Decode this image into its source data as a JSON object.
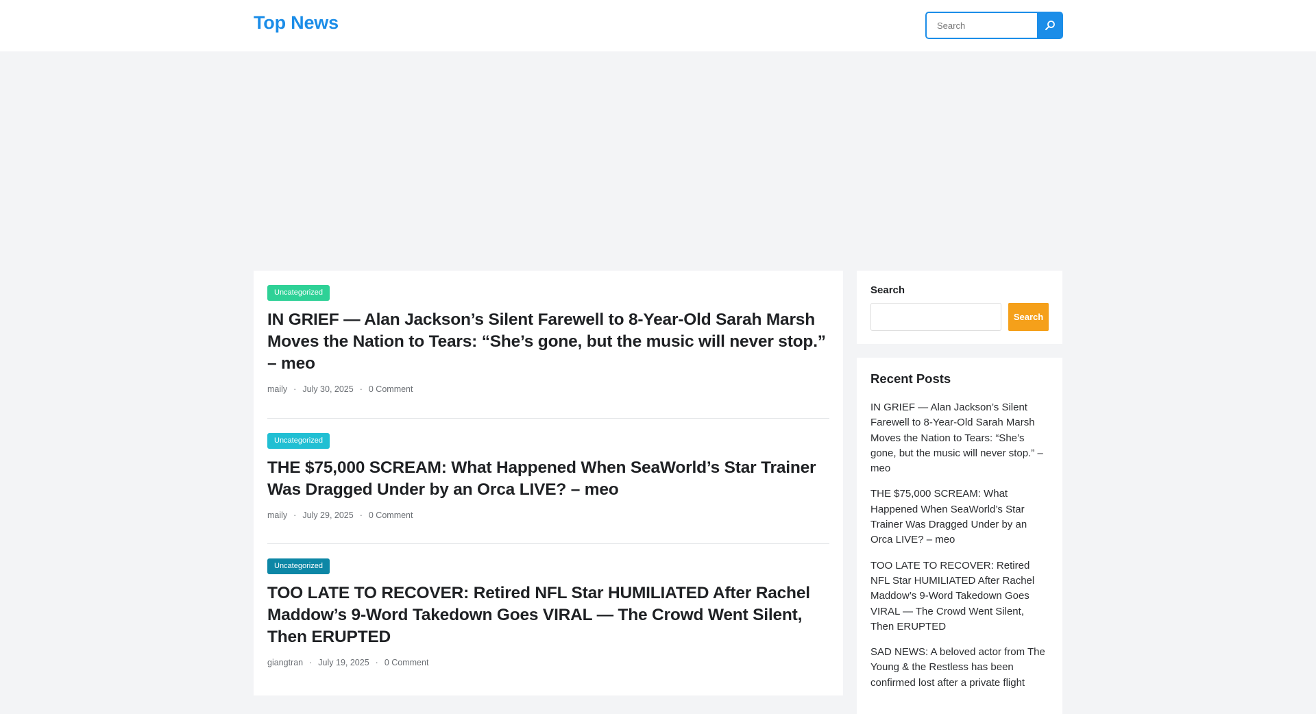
{
  "header": {
    "logo": "Top News",
    "search_placeholder": "Search",
    "search_icon": "search-icon"
  },
  "posts": [
    {
      "category": "Uncategorized",
      "category_color": "#2ed196",
      "title": "IN GRIEF — Alan Jackson’s Silent Farewell to 8-Year-Old Sarah Marsh Moves the Nation to Tears: “She’s gone, but the music will never stop.” – meo",
      "author": "maily",
      "date": "July 30, 2025",
      "comments": "0 Comment"
    },
    {
      "category": "Uncategorized",
      "category_color": "#21bfd3",
      "title": "THE $75,000 SCREAM: What Happened When SeaWorld’s Star Trainer Was Dragged Under by an Orca LIVE? – meo",
      "author": "maily",
      "date": "July 29, 2025",
      "comments": "0 Comment"
    },
    {
      "category": "Uncategorized",
      "category_color": "#0d87a6",
      "title": "TOO LATE TO RECOVER: Retired NFL Star HUMILIATED After Rachel Maddow’s 9-Word Takedown Goes VIRAL — The Crowd Went Silent, Then ERUPTED",
      "author": "giangtran",
      "date": "July 19, 2025",
      "comments": "0 Comment"
    }
  ],
  "sidebar": {
    "search_title": "Search",
    "search_button": "Search",
    "recent_title": "Recent Posts",
    "recent_posts": [
      "IN GRIEF — Alan Jackson’s Silent Farewell to 8-Year-Old Sarah Marsh Moves the Nation to Tears: “She’s gone, but the music will never stop.” – meo",
      "THE $75,000 SCREAM: What Happened When SeaWorld’s Star Trainer Was Dragged Under by an Orca LIVE? – meo",
      "TOO LATE TO RECOVER: Retired NFL Star HUMILIATED After Rachel Maddow’s 9-Word Takedown Goes VIRAL — The Crowd Went Silent, Then ERUPTED",
      "SAD NEWS: A beloved actor from The Young & the Restless has been confirmed lost after a private flight"
    ]
  },
  "colors": {
    "brand": "#1b8de8",
    "search_button": "#f5a01a"
  }
}
